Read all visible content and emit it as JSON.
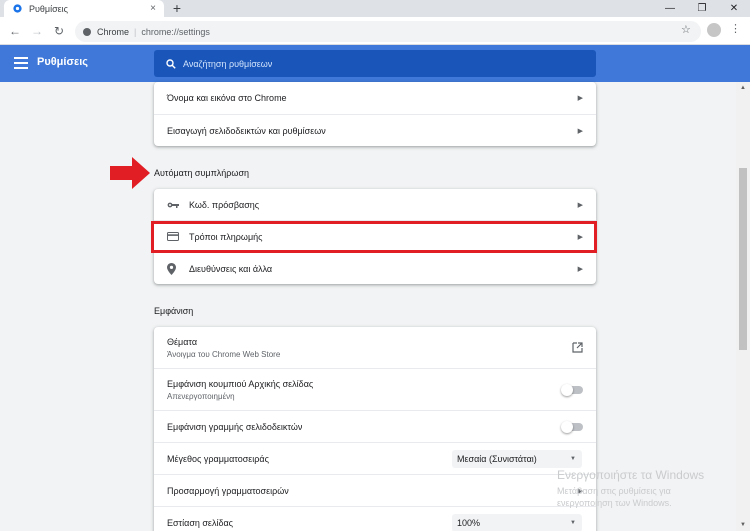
{
  "browser": {
    "tab_title": "Ρυθμίσεις",
    "tab_close": "×",
    "new_tab": "+",
    "win_min": "—",
    "win_restore": "❐",
    "win_close": "✕",
    "back": "←",
    "forward": "→",
    "reload": "↻",
    "omnibox_site": "Chrome",
    "omnibox_sep": "|",
    "omnibox_url": "chrome://settings",
    "star": "☆",
    "menu": "⋮"
  },
  "header": {
    "title": "Ρυθμίσεις",
    "search_placeholder": "Αναζήτηση ρυθμίσεων"
  },
  "people_rows": [
    {
      "label": "Όνομα και εικόνα στο Chrome"
    },
    {
      "label": "Εισαγωγή σελιδοδεικτών και ρυθμίσεων"
    }
  ],
  "autofill": {
    "title": "Αυτόματη συμπλήρωση",
    "rows": [
      {
        "label": "Κωδ. πρόσβασης",
        "icon": "key-icon"
      },
      {
        "label": "Τρόποι πληρωμής",
        "icon": "credit-card-icon"
      },
      {
        "label": "Διευθύνσεις και άλλα",
        "icon": "location-pin-icon"
      }
    ]
  },
  "appearance": {
    "title": "Εμφάνιση",
    "themes": {
      "label": "Θέματα",
      "sublabel": "Άνοιγμα του Chrome Web Store"
    },
    "home_button": {
      "label": "Εμφάνιση κουμπιού Αρχικής σελίδας",
      "sublabel": "Απενεργοποιημένη",
      "enabled": false
    },
    "bookmarks_bar": {
      "label": "Εμφάνιση γραμμής σελιδοδεικτών",
      "enabled": false
    },
    "font_size": {
      "label": "Μέγεθος γραμματοσειράς",
      "value": "Μεσαία (Συνιστάται)"
    },
    "customize_fonts": {
      "label": "Προσαρμογή γραμματοσειρών"
    },
    "page_zoom": {
      "label": "Εστίαση σελίδας",
      "value": "100%"
    }
  },
  "watermark": {
    "title": "Ενεργοποιήστε τα Windows",
    "line1": "Μετάβαση στις ρυθμίσεις για",
    "line2": "ενεργοποίηση των Windows."
  },
  "colors": {
    "header_blue": "#3f78d8",
    "search_blue": "#1a56b9",
    "highlight_red": "#e01e24"
  }
}
